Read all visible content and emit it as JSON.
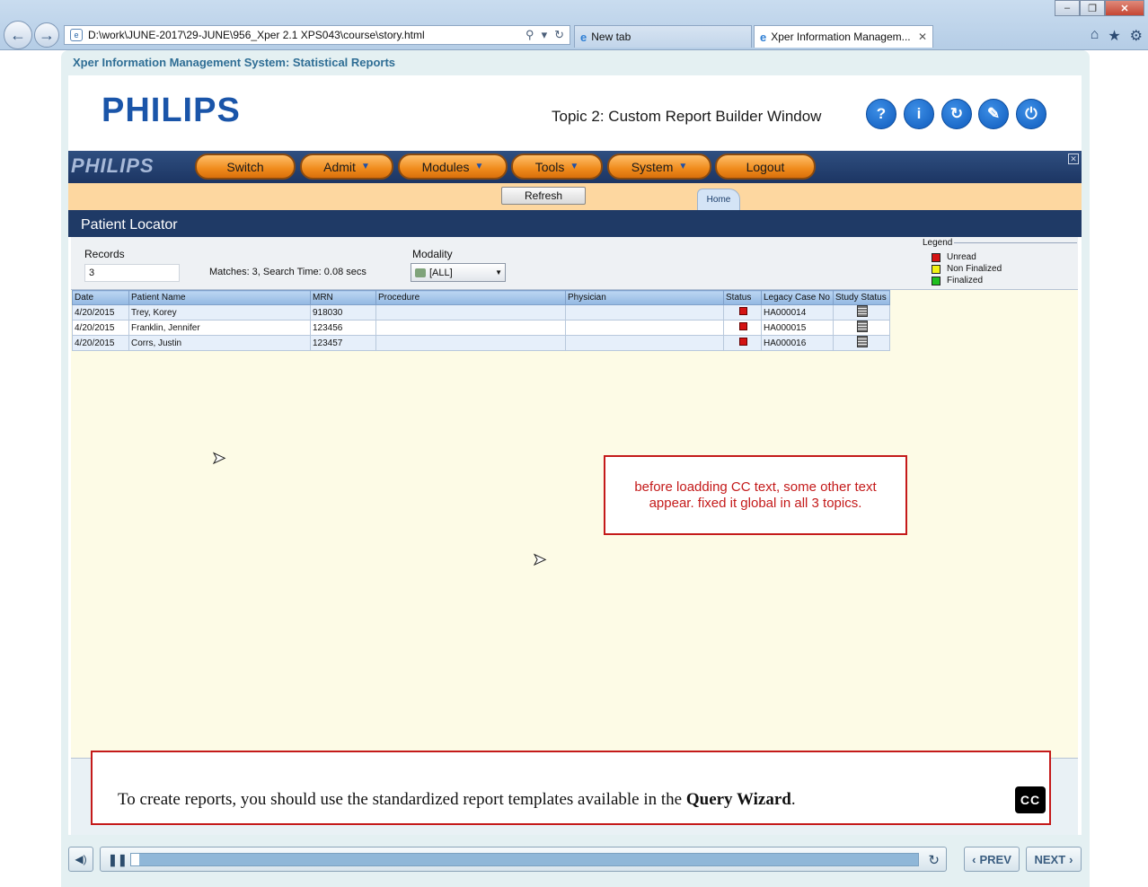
{
  "browser": {
    "url": "D:\\work\\JUNE-2017\\29-JUNE\\956_Xper 2.1 XPS043\\course\\story.html",
    "tabs": [
      {
        "label": "New tab"
      },
      {
        "label": "Xper Information Managem..."
      }
    ]
  },
  "course": {
    "title": "Xper Information Management System: Statistical Reports",
    "brand": "PHILIPS",
    "topic_title": "Topic 2: Custom Report Builder Window"
  },
  "app": {
    "logo": "PHILIPS",
    "menu": [
      {
        "label": "Switch"
      },
      {
        "label": "Admit"
      },
      {
        "label": "Modules"
      },
      {
        "label": "Tools"
      },
      {
        "label": "System"
      },
      {
        "label": "Logout"
      }
    ],
    "refresh_label": "Refresh",
    "home_tab": "Home",
    "section_title": "Patient Locator",
    "records_label": "Records",
    "records_value": "3",
    "matches_text": "Matches: 3, Search Time: 0.08 secs",
    "modality_label": "Modality",
    "modality_value": "[ALL]",
    "legend": {
      "title": "Legend",
      "items": [
        {
          "label": "Unread",
          "color": "#d41313"
        },
        {
          "label": "Non Finalized",
          "color": "#f2f213"
        },
        {
          "label": "Finalized",
          "color": "#1fbf1f"
        }
      ]
    },
    "table": {
      "columns": [
        "Date",
        "Patient Name",
        "MRN",
        "Procedure",
        "Physician",
        "Status",
        "Legacy Case No",
        "Study Status"
      ],
      "rows": [
        {
          "date": "4/20/2015",
          "name": "Trey, Korey",
          "mrn": "918030",
          "procedure": "",
          "physician": "",
          "legacy": "HA000014"
        },
        {
          "date": "4/20/2015",
          "name": "Franklin, Jennifer",
          "mrn": "123456",
          "procedure": "",
          "physician": "",
          "legacy": "HA000015"
        },
        {
          "date": "4/20/2015",
          "name": "Corrs, Justin",
          "mrn": "123457",
          "procedure": "",
          "physician": "",
          "legacy": "HA000016"
        }
      ]
    }
  },
  "note": "before loadding CC text, some other text appear. fixed it global in all 3 topics.",
  "caption": {
    "prefix": "To create reports, you should use the standardized report templates available in the ",
    "emphasis": "Query Wizard",
    "suffix": ".",
    "cc_label": "CC"
  },
  "player": {
    "progress": 0.01,
    "prev_label": "PREV",
    "next_label": "NEXT"
  }
}
